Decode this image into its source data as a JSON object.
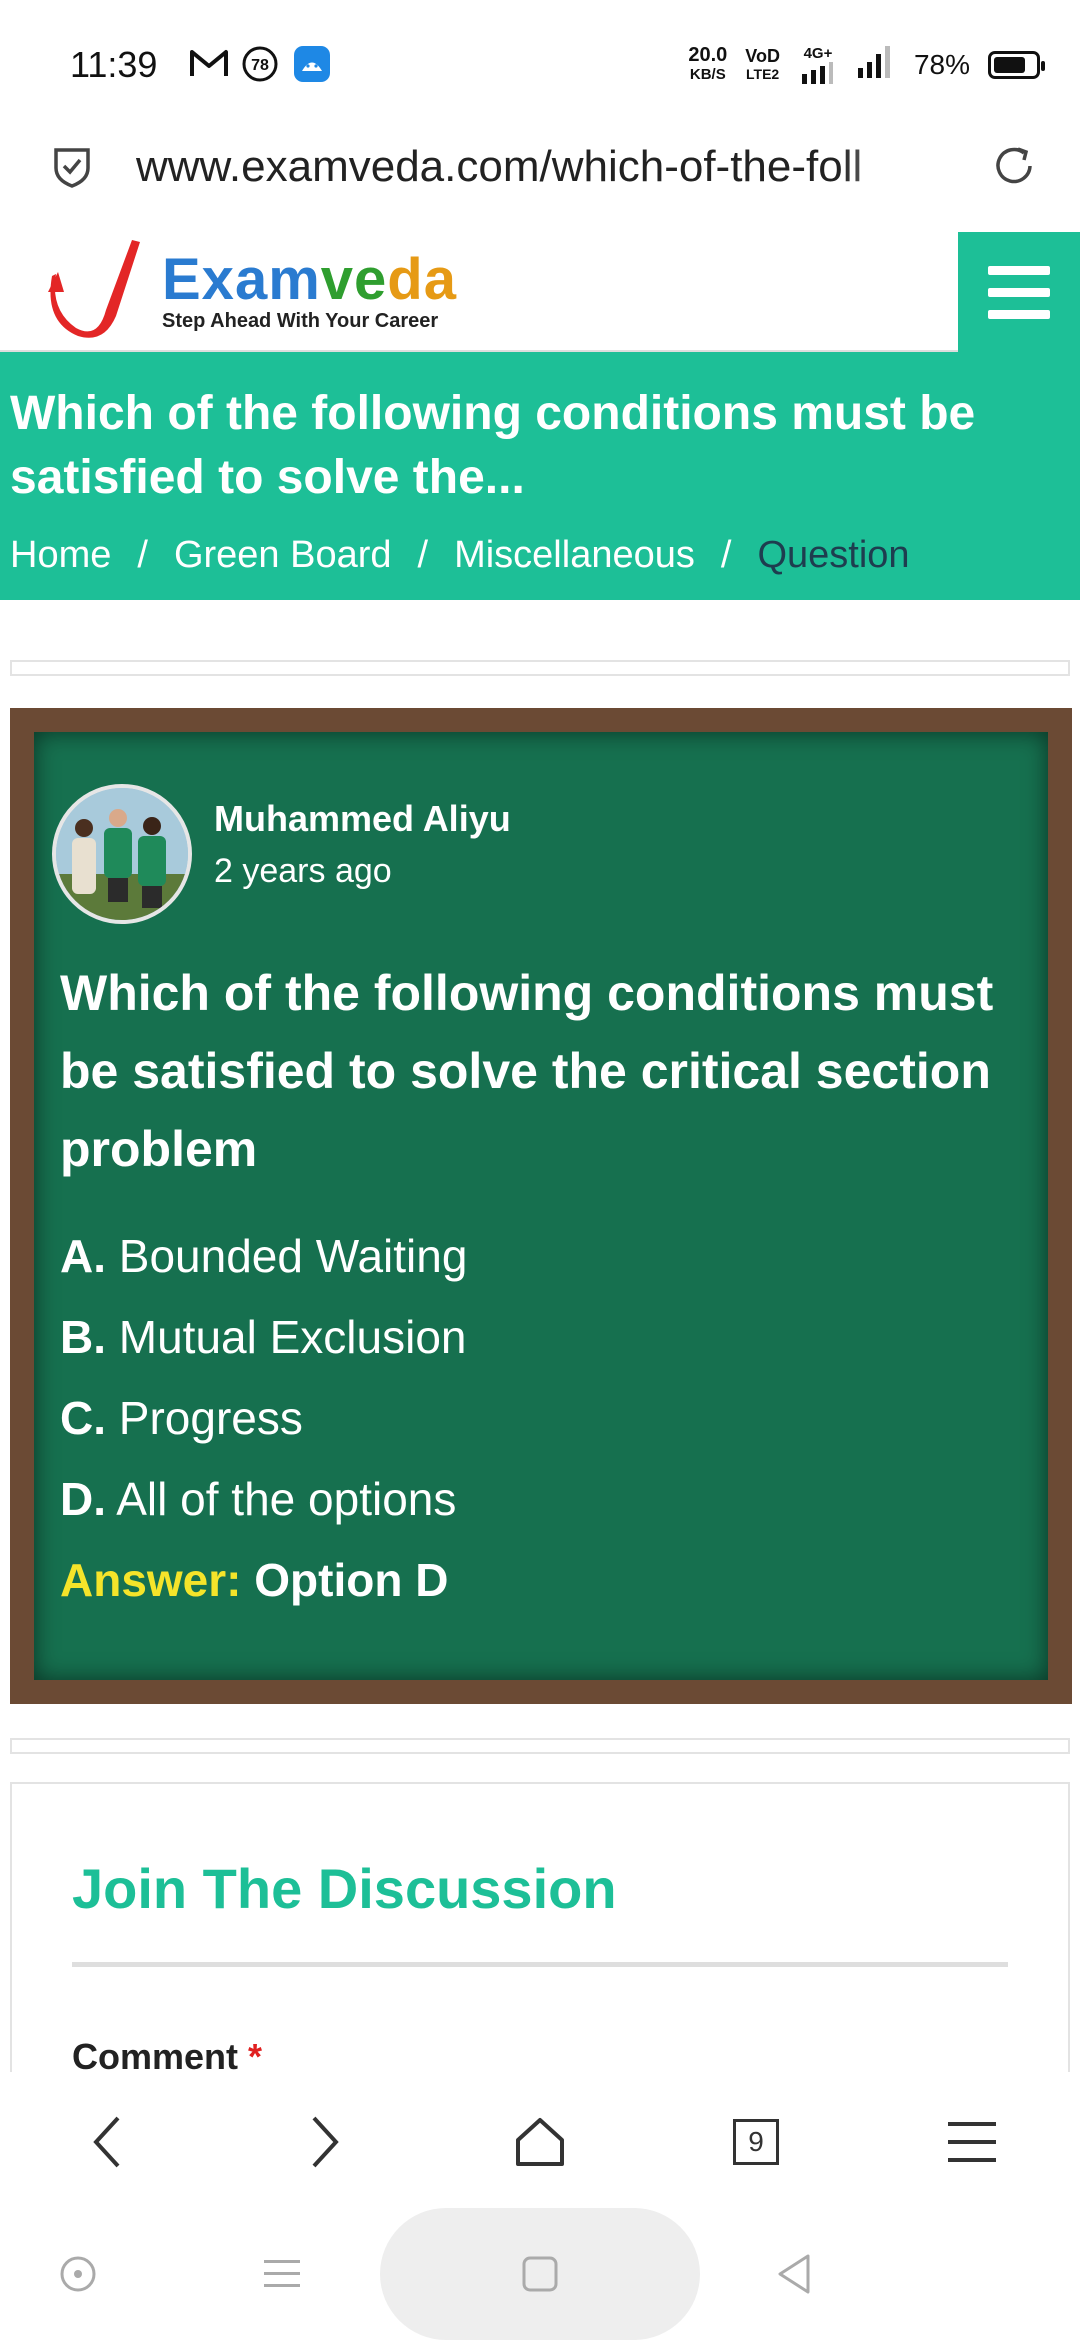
{
  "status_bar": {
    "time": "11:39",
    "notification_badge": "78",
    "net_speed_value": "20.0",
    "net_speed_unit": "KB/S",
    "volte_top": "VoD",
    "volte_bottom": "LTE2",
    "network_type": "4G+",
    "battery_percent": "78%",
    "battery_level": 0.78
  },
  "url_bar": {
    "url": "www.examveda.com/which-of-the-foll"
  },
  "site_header": {
    "logo_part1": "Exam",
    "logo_part2": "ve",
    "logo_part3": "da",
    "tagline": "Step Ahead With Your Career"
  },
  "title_band": {
    "title": "Which of the following conditions must be satisfied to solve the...",
    "breadcrumb": {
      "home": "Home",
      "green_board": "Green Board",
      "miscellaneous": "Miscellaneous",
      "current": "Question",
      "separator": "/"
    }
  },
  "board": {
    "author": "Muhammed Aliyu",
    "posted": "2 years ago",
    "question": "Which of the following conditions must be satisfied to solve the critical section problem",
    "options": [
      {
        "letter": "A.",
        "text": "Bounded Waiting"
      },
      {
        "letter": "B.",
        "text": "Mutual Exclusion"
      },
      {
        "letter": "C.",
        "text": "Progress"
      },
      {
        "letter": "D.",
        "text": "All of the options"
      }
    ],
    "answer_label": "Answer:",
    "answer_value": "Option D"
  },
  "discussion": {
    "title": "Join The Discussion",
    "comment_label": "Comment",
    "required_mark": "*"
  },
  "browser_nav": {
    "tabs_count": "9"
  },
  "colors": {
    "accent": "#1dbf97",
    "board_green": "#16704f",
    "board_frame": "#6b4a34",
    "answer_yellow": "#f5e42a"
  },
  "icons": [
    "gmail-icon",
    "notification-badge-icon",
    "app-icon",
    "wifi-4g-icon",
    "signal-icon",
    "battery-icon",
    "shield-check-icon",
    "reload-icon",
    "hamburger-menu-icon",
    "back-icon",
    "forward-icon",
    "home-icon",
    "tabs-icon",
    "browser-menu-icon",
    "assistant-icon",
    "recent-apps-icon",
    "home-square-icon",
    "system-back-icon"
  ]
}
